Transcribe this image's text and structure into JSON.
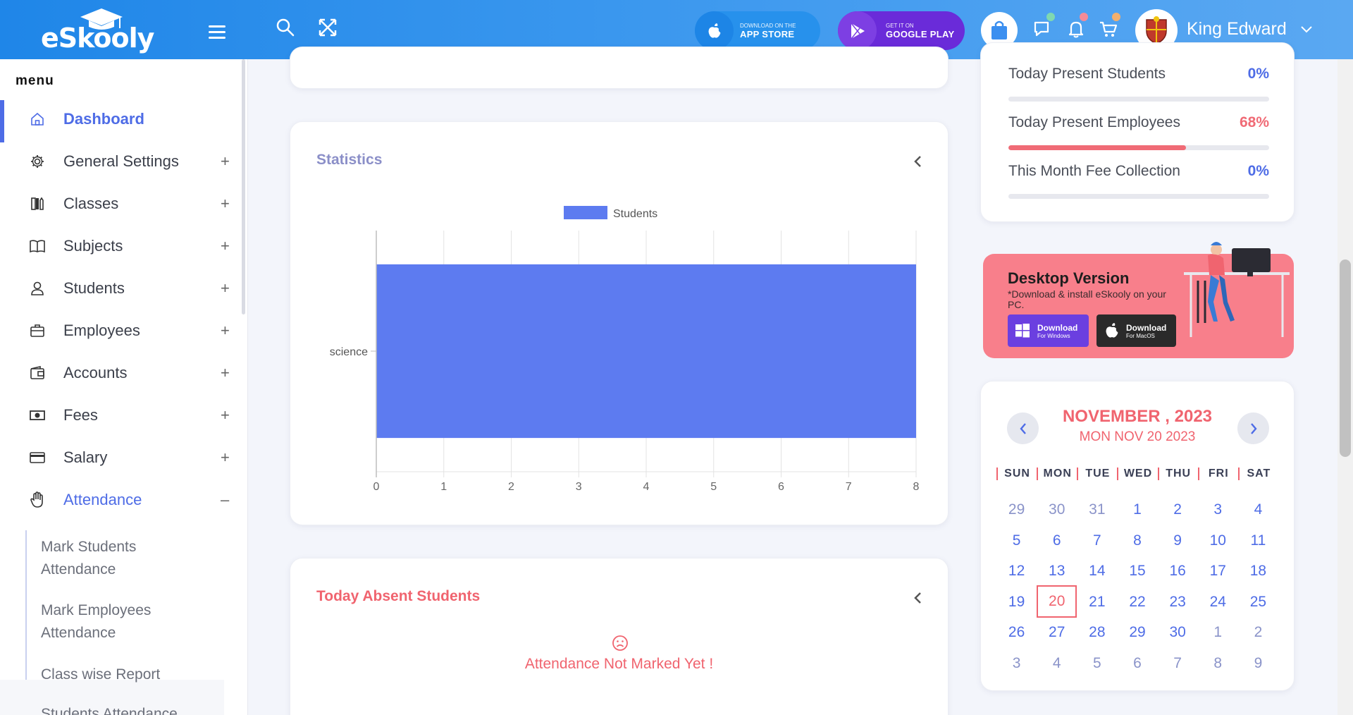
{
  "header": {
    "logo": "eSkooly",
    "app_store": {
      "small": "DOWNLOAD ON THE",
      "big": "APP STORE"
    },
    "google_play": {
      "small": "GET IT ON",
      "big": "GOOGLE PLAY"
    },
    "user_name": "King Edward",
    "colors": {
      "bg_start": "#1f86e8",
      "bg_end": "#5aa8f2",
      "gplay": "#6a2bd9"
    }
  },
  "sidebar": {
    "menu_title": "menu",
    "items": [
      {
        "label": "Dashboard",
        "icon": "home-icon",
        "expander": ""
      },
      {
        "label": "General Settings",
        "icon": "gear-icon",
        "expander": "+"
      },
      {
        "label": "Classes",
        "icon": "classes-icon",
        "expander": "+"
      },
      {
        "label": "Subjects",
        "icon": "book-icon",
        "expander": "+"
      },
      {
        "label": "Students",
        "icon": "user-icon",
        "expander": "+"
      },
      {
        "label": "Employees",
        "icon": "briefcase-icon",
        "expander": "+"
      },
      {
        "label": "Accounts",
        "icon": "wallet-icon",
        "expander": "+"
      },
      {
        "label": "Fees",
        "icon": "money-icon",
        "expander": "+"
      },
      {
        "label": "Salary",
        "icon": "card-icon",
        "expander": "+"
      },
      {
        "label": "Attendance",
        "icon": "hand-icon",
        "expander": "–"
      }
    ],
    "sub_items": [
      "Mark Students Attendance",
      "Mark Employees Attendance",
      "Class wise Report",
      "Students Attendance"
    ]
  },
  "statistics": {
    "title": "Statistics",
    "chart_data": {
      "type": "bar",
      "orientation": "horizontal",
      "categories": [
        "science"
      ],
      "series": [
        {
          "name": "Students",
          "values": [
            8
          ],
          "color": "#5d7bf0"
        }
      ],
      "xlim": [
        0,
        8
      ],
      "xticks": [
        0,
        1,
        2,
        3,
        4,
        5,
        6,
        7,
        8
      ],
      "legend": "top",
      "grid": true
    }
  },
  "absent": {
    "title": "Today Absent Students",
    "message": "Attendance Not Marked Yet !"
  },
  "stats": [
    {
      "label": "Today Present Students",
      "value": "0%",
      "percent": 0,
      "color": "#4e6ce6"
    },
    {
      "label": "Today Present Employees",
      "value": "68%",
      "percent": 68,
      "color": "#f06b76"
    },
    {
      "label": "This Month Fee Collection",
      "value": "0%",
      "percent": 0,
      "color": "#4e6ce6"
    }
  ],
  "desktop": {
    "title": "Desktop Version",
    "subtitle": "*Download & install eSkooly on your PC.",
    "windows_btn": {
      "line1": "Download",
      "line2": "For Windows"
    },
    "mac_btn": {
      "line1": "Download",
      "line2": "For MacOS"
    }
  },
  "calendar": {
    "month": "NOVEMBER , 2023",
    "date": "MON NOV 20 2023",
    "days": [
      "SUN",
      "MON",
      "TUE",
      "WED",
      "THU",
      "FRI",
      "SAT"
    ],
    "weeks": [
      [
        {
          "d": "29",
          "m": true
        },
        {
          "d": "30",
          "m": true
        },
        {
          "d": "31",
          "m": true
        },
        {
          "d": "1"
        },
        {
          "d": "2"
        },
        {
          "d": "3"
        },
        {
          "d": "4"
        }
      ],
      [
        {
          "d": "5"
        },
        {
          "d": "6"
        },
        {
          "d": "7"
        },
        {
          "d": "8"
        },
        {
          "d": "9"
        },
        {
          "d": "10"
        },
        {
          "d": "11"
        }
      ],
      [
        {
          "d": "12"
        },
        {
          "d": "13"
        },
        {
          "d": "14"
        },
        {
          "d": "15"
        },
        {
          "d": "16"
        },
        {
          "d": "17"
        },
        {
          "d": "18"
        }
      ],
      [
        {
          "d": "19"
        },
        {
          "d": "20",
          "today": true
        },
        {
          "d": "21"
        },
        {
          "d": "22"
        },
        {
          "d": "23"
        },
        {
          "d": "24"
        },
        {
          "d": "25"
        }
      ],
      [
        {
          "d": "26"
        },
        {
          "d": "27"
        },
        {
          "d": "28"
        },
        {
          "d": "29"
        },
        {
          "d": "30"
        },
        {
          "d": "1",
          "m": true
        },
        {
          "d": "2",
          "m": true
        }
      ],
      [
        {
          "d": "3",
          "m": true
        },
        {
          "d": "4",
          "m": true
        },
        {
          "d": "5",
          "m": true
        },
        {
          "d": "6",
          "m": true
        },
        {
          "d": "7",
          "m": true
        },
        {
          "d": "8",
          "m": true
        },
        {
          "d": "9",
          "m": true
        }
      ]
    ]
  }
}
